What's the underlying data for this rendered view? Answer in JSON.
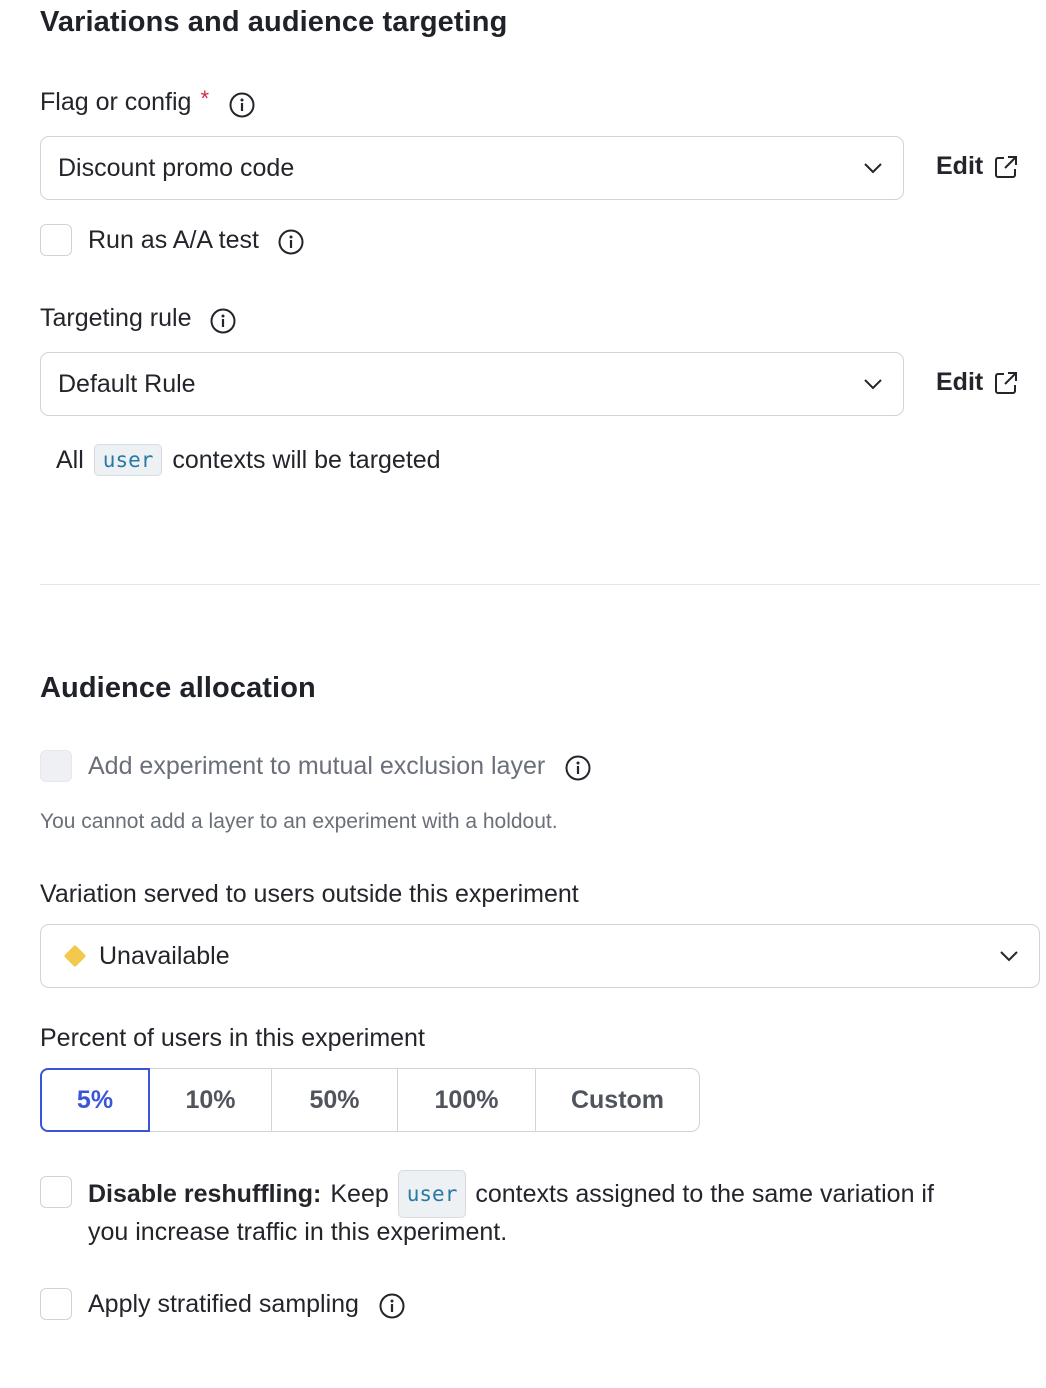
{
  "section1": {
    "title": "Variations and audience targeting",
    "flag": {
      "label": "Flag or config",
      "required": "*",
      "value": "Discount promo code",
      "edit_label": "Edit"
    },
    "aa_test": {
      "label": "Run as A/A test",
      "checked": false
    },
    "targeting": {
      "label": "Targeting rule",
      "value": "Default Rule",
      "edit_label": "Edit",
      "note_prefix": "All",
      "note_code": "user",
      "note_suffix": "contexts will be targeted"
    }
  },
  "section2": {
    "title": "Audience allocation",
    "mutex": {
      "label": "Add experiment to mutual exclusion layer",
      "disabled": true
    },
    "mutex_help": "You cannot add a layer to an experiment with a holdout.",
    "outside": {
      "label": "Variation served to users outside this experiment",
      "value": "Unavailable",
      "color": "#f2c94c"
    },
    "percent": {
      "label": "Percent of users in this experiment",
      "options": [
        "5%",
        "10%",
        "50%",
        "100%",
        "Custom"
      ],
      "selected": "5%",
      "accent": "#3b55d9"
    },
    "reshuffle": {
      "bold": "Disable reshuffling:",
      "text_before": "Keep",
      "code": "user",
      "text_after": "contexts assigned to the same variation if",
      "text_line2": "you increase traffic in this experiment."
    },
    "stratified": {
      "label": "Apply stratified sampling"
    }
  }
}
